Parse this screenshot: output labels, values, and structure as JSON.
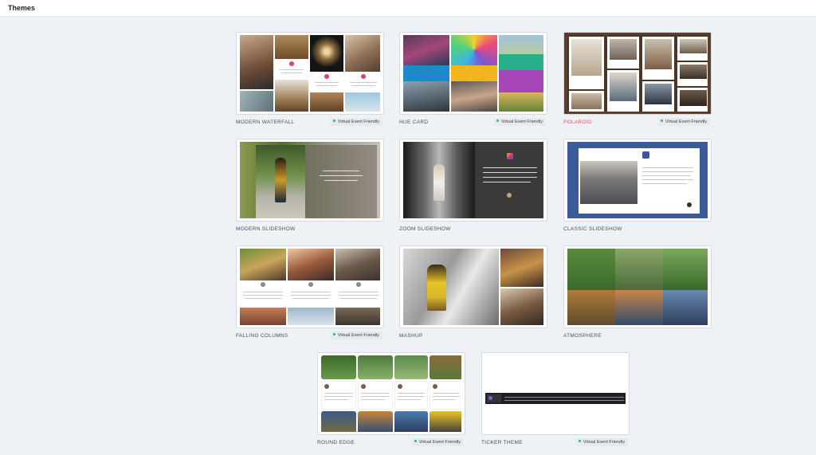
{
  "header": {
    "title": "Themes"
  },
  "badge_text": "Virtual Event Friendly",
  "themes": [
    {
      "label": "MODERN WATERFALL",
      "badge": true,
      "selected": false
    },
    {
      "label": "HUE CARD",
      "badge": true,
      "selected": false
    },
    {
      "label": "POLAROID",
      "badge": true,
      "selected": true
    },
    {
      "label": "MODERN SLIDESHOW",
      "badge": false,
      "selected": false
    },
    {
      "label": "ZOOM SLIDESHOW",
      "badge": false,
      "selected": false
    },
    {
      "label": "CLASSIC SLIDESHOW",
      "badge": false,
      "selected": false
    },
    {
      "label": "FALLING COLUMNS",
      "badge": true,
      "selected": false
    },
    {
      "label": "MASHUP",
      "badge": false,
      "selected": false
    },
    {
      "label": "ATMOSPHERE",
      "badge": false,
      "selected": false
    },
    {
      "label": "ROUND EDGE",
      "badge": true,
      "selected": false
    },
    {
      "label": "TICKER THEME",
      "badge": true,
      "selected": false
    }
  ],
  "colors": {
    "accent": "#e4545c",
    "badge_dot": "#35b56a",
    "page_bg": "#eef1f6"
  }
}
